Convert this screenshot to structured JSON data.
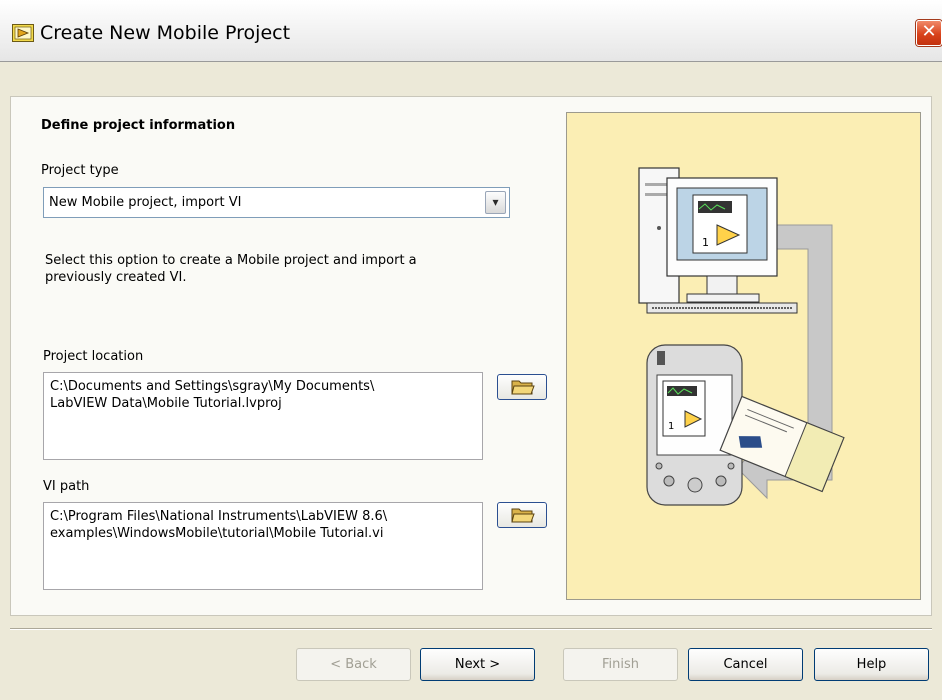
{
  "window": {
    "title": "Create New Mobile Project",
    "close_glyph": "✕"
  },
  "section": {
    "title": "Define project information"
  },
  "project_type": {
    "label": "Project type",
    "selected": "New Mobile project, import VI",
    "dropdown_glyph": "▾",
    "description": "Select this option to create a Mobile project and import a previously created VI."
  },
  "project_location": {
    "label": "Project location",
    "value": "C:\\Documents and Settings\\sgray\\My Documents\\\nLabVIEW Data\\Mobile Tutorial.lvproj"
  },
  "vi_path": {
    "label": "VI path",
    "value": "C:\\Program Files\\National Instruments\\LabVIEW 8.6\\\nexamples\\WindowsMobile\\tutorial\\Mobile Tutorial.vi"
  },
  "illustration": {
    "numeric_glyph": "1"
  },
  "buttons": {
    "back": "< Back",
    "next": "Next >",
    "finish": "Finish",
    "cancel": "Cancel",
    "help": "Help"
  },
  "colors": {
    "illustration_bg": "#fbeeb4",
    "button_border": "#003c74",
    "close_red": "#d9431c"
  }
}
